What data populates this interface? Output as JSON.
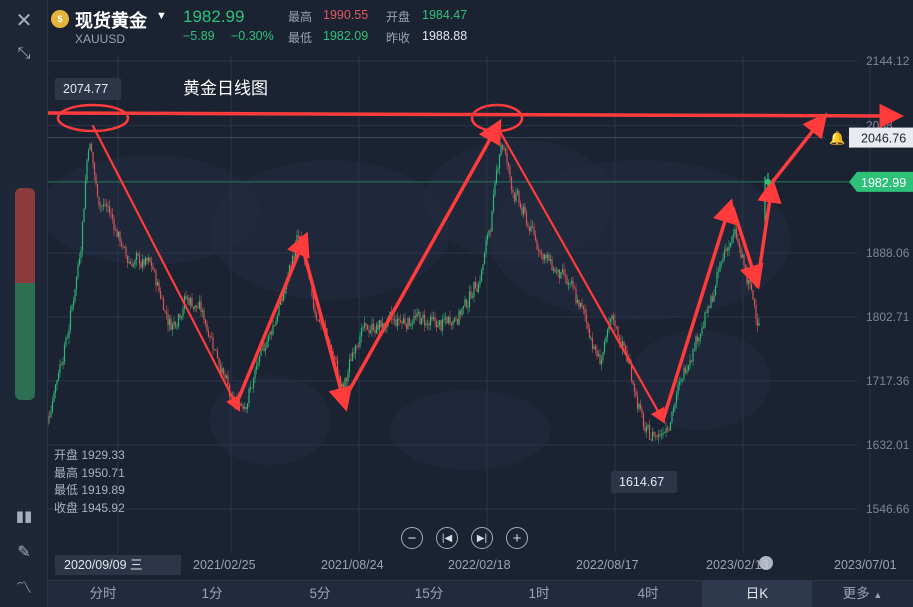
{
  "header": {
    "logo_glyph": "$",
    "name": "现货黄金",
    "code": "XAUUSD",
    "price": "1982.99",
    "change": "−5.89",
    "change_pct": "−0.30%",
    "high_label": "最高",
    "high_value": "1990.55",
    "open_label": "开盘",
    "open_value": "1984.47",
    "low_label": "最低",
    "low_value": "1982.09",
    "prev_label": "昨收",
    "prev_value": "1988.88"
  },
  "overlay": {
    "title": "黄金日线图",
    "ohlc": [
      {
        "label": "开盘",
        "value": "1929.33"
      },
      {
        "label": "最高",
        "value": "1950.71"
      },
      {
        "label": "最低",
        "value": "1919.89"
      },
      {
        "label": "收盘",
        "value": "1945.92"
      }
    ]
  },
  "colors": {
    "up": "#2ec17a",
    "down": "#e05a5a",
    "annotation": "#ff3b3b",
    "background": "#1b2333"
  },
  "icons": [
    "close-icon",
    "collapse-icon",
    "candlestick-icon",
    "pencil-icon",
    "indicator-icon",
    "bell-icon",
    "zoom-out-icon",
    "step-back-icon",
    "step-forward-icon",
    "zoom-in-icon"
  ],
  "timeframes": [
    "分时",
    "1分",
    "5分",
    "15分",
    "1时",
    "4时",
    "日K",
    "更多"
  ],
  "timeframe_active": "日K",
  "chart_data": {
    "type": "candlestick",
    "title": "黄金日线图",
    "y_ticks": [
      "2144.12",
      "2058",
      "1888.06",
      "1802.71",
      "1717.36",
      "1632.01",
      "1546.66"
    ],
    "y_range": [
      1546.66,
      2144.12
    ],
    "x_ticks": [
      "2020/09/09 三",
      "2021/02/25",
      "2021/08/24",
      "2022/02/18",
      "2022/08/17",
      "2023/02/13",
      "2023/07/01"
    ],
    "current_price": "1982.99",
    "alert_price": "2046.76",
    "labels": {
      "high": "2074.77",
      "low": "1614.67"
    },
    "trend_path_prices": [
      {
        "date": "2020-08-07",
        "price": 2074.77
      },
      {
        "date": "2021-03-08",
        "price": 1677
      },
      {
        "date": "2021-06-01",
        "price": 1916
      },
      {
        "date": "2021-08-09",
        "price": 1682
      },
      {
        "date": "2022-03-08",
        "price": 2070
      },
      {
        "date": "2022-09-28",
        "price": 1618
      },
      {
        "date": "2023-02-01",
        "price": 1959
      },
      {
        "date": "2023-02-28",
        "price": 1804
      },
      {
        "date": "2023-03-20",
        "price": 2009
      },
      {
        "date": "2023-04-13",
        "price": 2048
      }
    ],
    "resistance": 2074.77
  }
}
